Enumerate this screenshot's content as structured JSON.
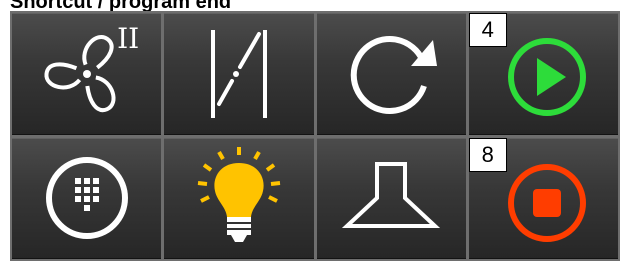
{
  "title": "Shortcut / program end",
  "tiles": [
    {
      "name": "fan",
      "level_label": "II"
    },
    {
      "name": "door"
    },
    {
      "name": "repeat"
    },
    {
      "name": "start",
      "badge": "4",
      "color": "#2ddc3a"
    },
    {
      "name": "keypad"
    },
    {
      "name": "light",
      "color": "#ffc300"
    },
    {
      "name": "hood"
    },
    {
      "name": "stop",
      "badge": "8",
      "color": "#ff3d00"
    }
  ],
  "icons": [
    "fan-icon",
    "door-icon",
    "repeat-icon",
    "play-icon",
    "keypad-icon",
    "light-bulb-icon",
    "hood-icon",
    "stop-icon"
  ]
}
